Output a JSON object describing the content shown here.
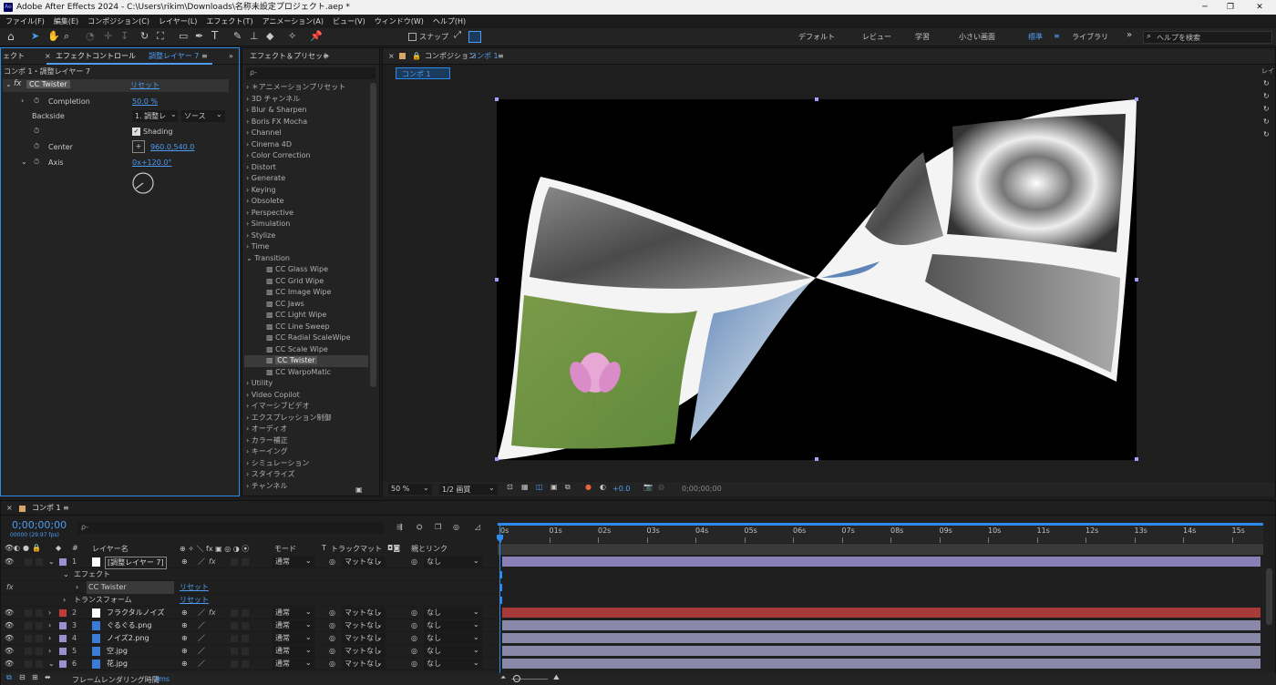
{
  "window": {
    "title": "Adobe After Effects 2024 - C:\\Users\\rikim\\Downloads\\名称未設定プロジェクト.aep *",
    "app_icon": "Ae"
  },
  "menu": [
    "ファイル(F)",
    "編集(E)",
    "コンポジション(C)",
    "レイヤー(L)",
    "エフェクト(T)",
    "アニメーション(A)",
    "ビュー(V)",
    "ウィンドウ(W)",
    "ヘルプ(H)"
  ],
  "toolbar": {
    "snap_label": "スナップ",
    "workspaces": [
      "デフォルト",
      "レビュー",
      "学習",
      "小さい画面",
      "標準",
      "ライブラリ"
    ],
    "active_workspace": "標準",
    "help_placeholder": "ヘルプを検索"
  },
  "effect_controls": {
    "tab_left": "ェクト",
    "tab_title": "エフェクトコントロール",
    "tab_layer": "調整レイヤー 7",
    "breadcrumb": "コンポ 1・調整レイヤー 7",
    "effect_name": "CC Twister",
    "reset_label": "リセット",
    "props": [
      {
        "name": "Completion",
        "value": "50.0 %"
      },
      {
        "name": "Backside",
        "value": "1. 調整レ",
        "value2": "ソース"
      },
      {
        "name": "",
        "value": "Shading"
      },
      {
        "name": "Center",
        "value": "960.0,540.0"
      },
      {
        "name": "Axis",
        "value": "0x+120.0°"
      }
    ]
  },
  "effects_presets": {
    "title": "エフェクト＆プリセット",
    "search_placeholder": "ρ-",
    "categories": [
      "＊アニメーションプリセット",
      "3D チャンネル",
      "Blur & Sharpen",
      "Boris FX Mocha",
      "Channel",
      "Cinema 4D",
      "Color Correction",
      "Distort",
      "Generate",
      "Keying",
      "Obsolete",
      "Perspective",
      "Simulation",
      "Stylize",
      "Time"
    ],
    "open_category": "Transition",
    "transition_items": [
      "CC Glass Wipe",
      "CC Grid Wipe",
      "CC Image Wipe",
      "CC Jaws",
      "CC Light Wipe",
      "CC Line Sweep",
      "CC Radial ScaleWipe",
      "CC Scale Wipe",
      "CC Twister",
      "CC WarpoMatic"
    ],
    "selected_item": "CC Twister",
    "after_categories": [
      "Utility",
      "Video Copilot",
      "イマーシブビデオ",
      "エクスプレッション制御",
      "オーディオ",
      "カラー補正",
      "キーイング",
      "シミュレーション",
      "スタイライズ",
      "チャンネル"
    ]
  },
  "composition": {
    "tab_label": "コンポジション",
    "comp_name": "コンポ 1",
    "sub_tab": "コンポ 1",
    "zoom": "50 %",
    "resolution": "1/2 画質",
    "exposure": "+0.0",
    "timecode": "0;00;00;00"
  },
  "timeline": {
    "tab": "コンポ 1",
    "timecode": "0;00;00;00",
    "fps": "00000 (29.97 fps)",
    "search_placeholder": "ρ-",
    "col_layer_name": "レイヤー名",
    "col_mode": "モード",
    "col_t": "T",
    "col_trackmatte": "トラックマット",
    "col_parent": "親とリンク",
    "ticks": [
      "0s",
      "01s",
      "02s",
      "03s",
      "04s",
      "05s",
      "06s",
      "07s",
      "08s",
      "09s",
      "10s",
      "11s",
      "12s",
      "13s",
      "14s",
      "15s"
    ],
    "sub_effect": "エフェクト",
    "sub_effect_name": "CC Twister",
    "sub_reset": "リセット",
    "sub_transform": "トランスフォーム",
    "layers": [
      {
        "num": "1",
        "name": "[調整レイヤー 7]",
        "mode": "通常",
        "matte": "マットなし",
        "parent": "なし",
        "label_color": "#9c8fd0",
        "bar_color": "#8a80b8"
      },
      {
        "num": "2",
        "name": "フラクタルノイズ",
        "mode": "通常",
        "matte": "マットなし",
        "parent": "なし",
        "label_color": "#c23b3b",
        "bar_color": "#a83a3a"
      },
      {
        "num": "3",
        "name": "ぐるぐる.png",
        "mode": "通常",
        "matte": "マットなし",
        "parent": "なし",
        "label_color": "#9c8fd0",
        "bar_color": "#8a88a8"
      },
      {
        "num": "4",
        "name": "ノイズ2.png",
        "mode": "通常",
        "matte": "マットなし",
        "parent": "なし",
        "label_color": "#9c8fd0",
        "bar_color": "#8a88a8"
      },
      {
        "num": "5",
        "name": "空.jpg",
        "mode": "通常",
        "matte": "マットなし",
        "parent": "なし",
        "label_color": "#9c8fd0",
        "bar_color": "#8a88a8"
      },
      {
        "num": "6",
        "name": "花.jpg",
        "mode": "通常",
        "matte": "マットなし",
        "parent": "なし",
        "label_color": "#9c8fd0",
        "bar_color": "#8a88a8"
      }
    ],
    "footer_label": "フレームレンダリング時間",
    "footer_value": "9ms"
  },
  "colors": {
    "accent": "#4e9cf2",
    "panel": "#232323",
    "selection": "#2d8ceb"
  }
}
